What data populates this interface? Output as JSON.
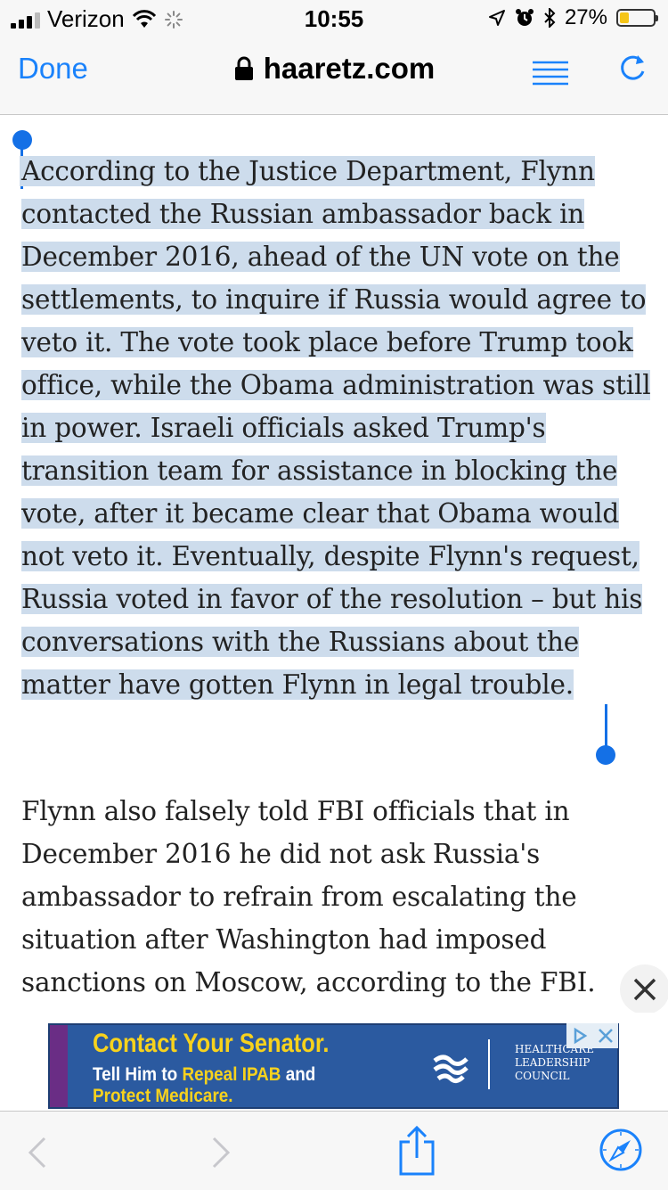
{
  "status_bar": {
    "carrier": "Verizon",
    "time": "10:55",
    "battery_percent": "27%",
    "battery_level": 0.27,
    "battery_color": "#f5c518"
  },
  "nav": {
    "done_label": "Done",
    "domain": "haaretz.com",
    "accent_color": "#1a82fb"
  },
  "article": {
    "selected_paragraph": "According to the Justice Department, Flynn contacted the Russian ambassador back in December 2016, ahead of the UN vote on the settlements, to inquire if Russia would agree to veto it. The vote took place before Trump took office, while the Obama administration was still in power. Israeli officials asked Trump's transition team for assistance in blocking the vote, after it became clear that Obama would not veto it. Eventually, despite Flynn's request, Russia voted in favor of the resolution – but his conversations with the Russians about the matter have gotten Flynn in legal trouble.",
    "next_paragraph": "Flynn also falsely told FBI officials that in December 2016 he did not ask Russia's ambassador to refrain from escalating the situation after Washington had imposed sanctions on Moscow, according to the FBI."
  },
  "ad": {
    "headline": "Contact Your Senator.",
    "line2_a": "Tell Him to ",
    "line2_b": "Repeal IPAB",
    "line2_c": " and",
    "line3": "Protect Medicare.",
    "org_line1": "HEALTHCARE",
    "org_line2": "LEADERSHIP",
    "org_line3": "COUNCIL"
  },
  "icons": {
    "signal": "signal-bars-icon",
    "wifi": "wifi-icon",
    "activity": "activity-spinner-icon",
    "location": "location-arrow-icon",
    "alarm": "alarm-icon",
    "bluetooth": "bluetooth-icon",
    "lock": "lock-icon",
    "reader": "reader-mode-icon",
    "reload": "reload-icon",
    "close": "close-icon",
    "back": "chevron-left-icon",
    "forward": "chevron-right-icon",
    "share": "share-icon",
    "compass": "safari-compass-icon"
  }
}
